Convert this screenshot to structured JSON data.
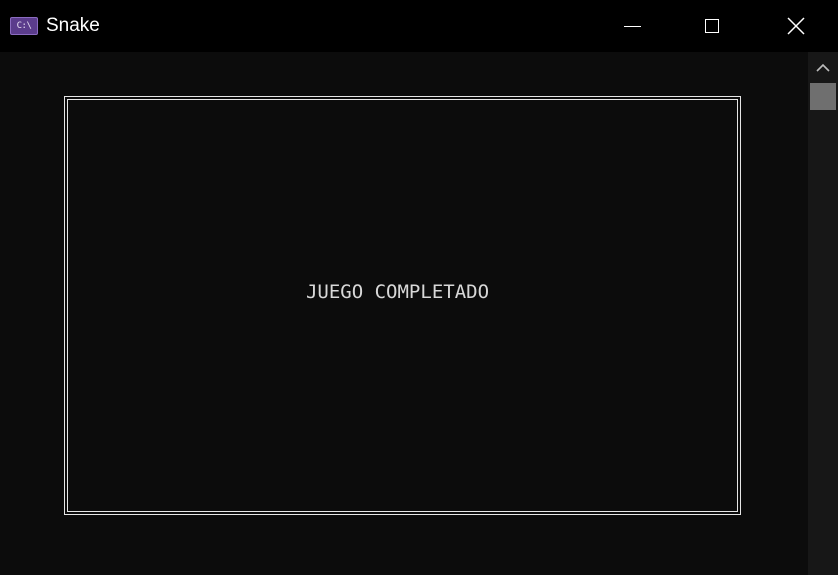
{
  "window": {
    "title": "Snake",
    "icon": "console-icon",
    "icon_text": "C:\\"
  },
  "controls": {
    "minimize": "minimize-icon",
    "maximize": "maximize-icon",
    "close": "close-icon"
  },
  "game": {
    "message": "JUEGO COMPLETADO"
  },
  "colors": {
    "titlebar_bg": "#000000",
    "console_bg": "#0c0c0c",
    "border": "#e6e6e6",
    "text": "#d8d8d8",
    "scrollbar_track": "#171717",
    "scrollbar_thumb": "#6f6f6f",
    "icon_accent": "#5b3c8c"
  }
}
